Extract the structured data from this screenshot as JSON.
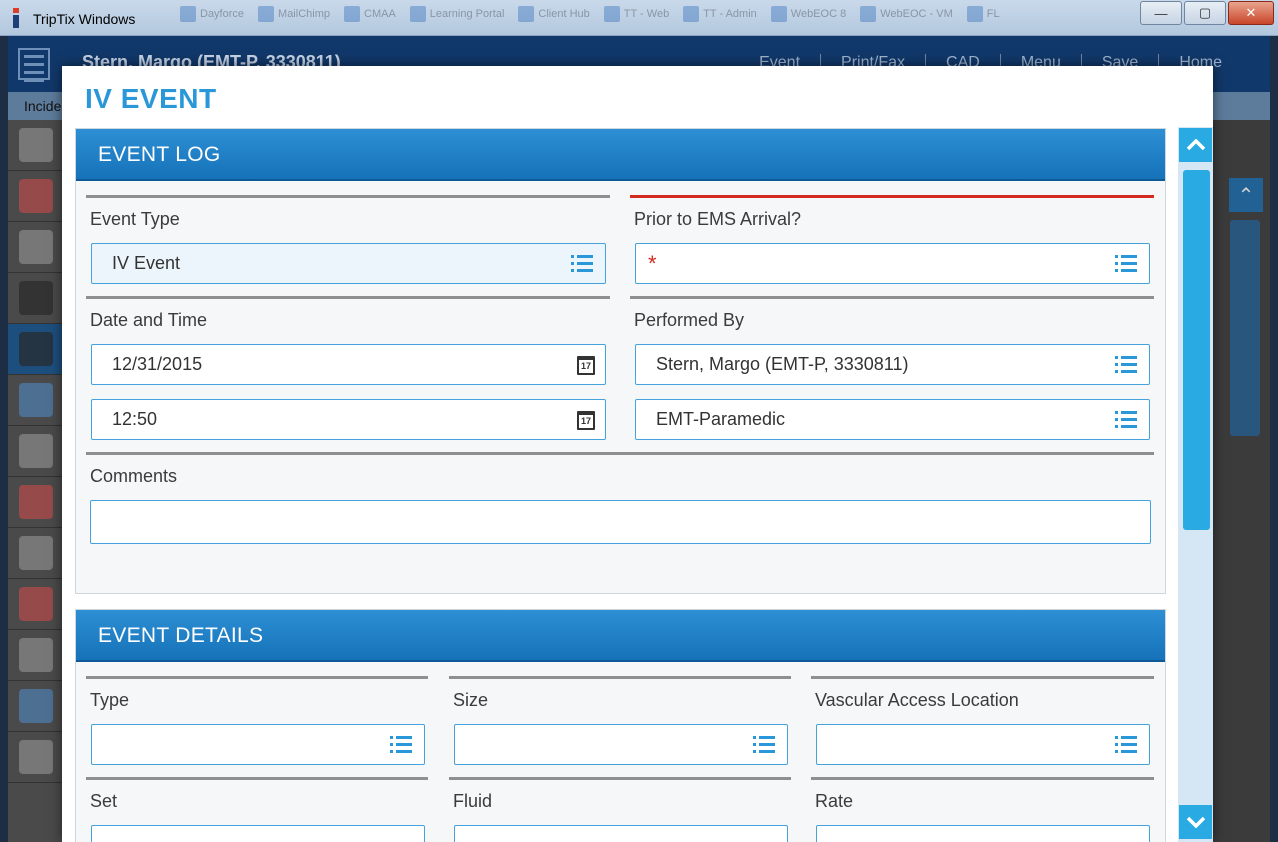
{
  "window": {
    "title": "TripTix Windows",
    "taskbar_tabs": [
      "Dayforce",
      "MailChimp",
      "CMAA",
      "Learning Portal",
      "Client Hub",
      "TT - Web",
      "TT - Admin",
      "WebEOC 8",
      "WebEOC - VM",
      "FL"
    ],
    "minimize": "—",
    "maximize": "▢",
    "close": "✕"
  },
  "app": {
    "patient": "Stern, Margo (EMT-P, 3330811)",
    "nav": [
      "Event",
      "Print/Fax",
      "CAD",
      "Menu",
      "Save",
      "Home"
    ],
    "subbar": "Incide"
  },
  "modal": {
    "title": "IV EVENT",
    "event_log": {
      "heading": "EVENT LOG",
      "event_type": {
        "label": "Event Type",
        "value": "IV Event"
      },
      "prior_to_ems": {
        "label": "Prior to EMS Arrival?",
        "value": "*"
      },
      "date_time": {
        "label": "Date and Time",
        "date": "12/31/2015",
        "time": "12:50"
      },
      "performed_by": {
        "label": "Performed By",
        "name": "Stern, Margo (EMT-P, 3330811)",
        "role": "EMT-Paramedic"
      },
      "comments": {
        "label": "Comments",
        "value": ""
      }
    },
    "event_details": {
      "heading": "EVENT DETAILS",
      "type": {
        "label": "Type",
        "value": ""
      },
      "size": {
        "label": "Size",
        "value": ""
      },
      "location": {
        "label": "Vascular Access Location",
        "value": ""
      },
      "set": {
        "label": "Set",
        "value": ""
      },
      "fluid": {
        "label": "Fluid",
        "value": ""
      },
      "rate": {
        "label": "Rate",
        "value": ""
      }
    },
    "calendar_day": "17"
  },
  "colors": {
    "accent": "#2a97d8",
    "header_bg": "#1672b9",
    "required": "#d42b20"
  }
}
